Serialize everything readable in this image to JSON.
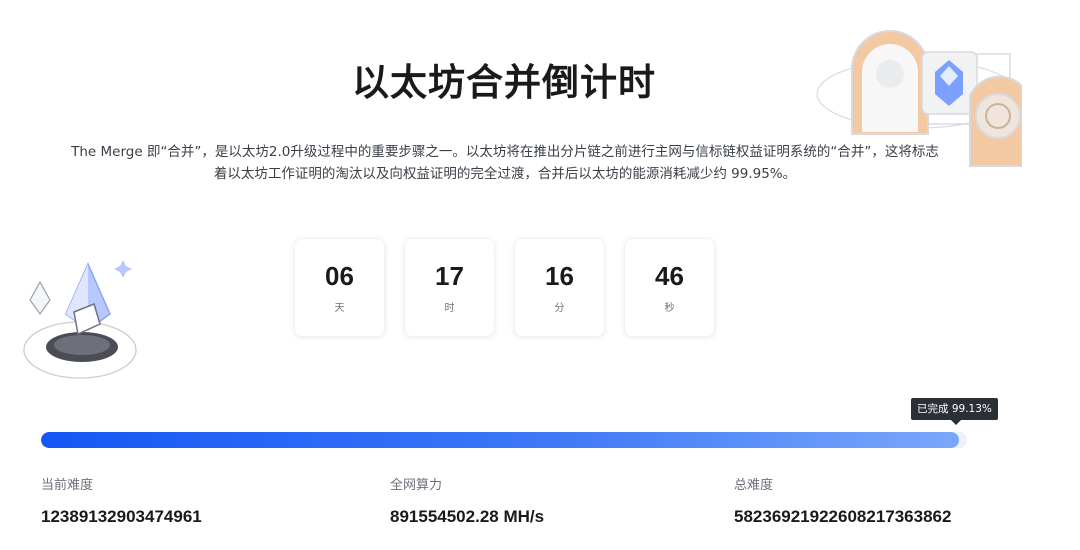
{
  "header": {
    "title": "以太坊合并倒计时",
    "description_line1": "The Merge 即“合并”，是以太坊2.0升级过程中的重要步骤之一。以太坊将在推出分片链之前进行主网与信标链权益证明系统的“合并”，这将标志",
    "description_line2": "着以太坊工作证明的淘汰以及向权益证明的完全过渡，合并后以太坊的能源消耗减少约 99.95%。"
  },
  "countdown": [
    {
      "value": "06",
      "unit": "天"
    },
    {
      "value": "17",
      "unit": "时"
    },
    {
      "value": "16",
      "unit": "分"
    },
    {
      "value": "46",
      "unit": "秒"
    }
  ],
  "progress": {
    "tooltip": "已完成 99.13%",
    "fraction": 0.9913
  },
  "stats": [
    {
      "label": "当前难度",
      "value": "12389132903474961"
    },
    {
      "label": "全网算力",
      "value": "891554502.28 MH/s"
    },
    {
      "label": "总难度",
      "value": "58236921922608217363862"
    }
  ],
  "colors": {
    "accent": "#1557f5",
    "tooltip_bg": "#2b2f36"
  },
  "icons": {
    "top_illustration": "ethereum-merge-illustration",
    "left_illustration": "ethereum-crystal-icon"
  }
}
